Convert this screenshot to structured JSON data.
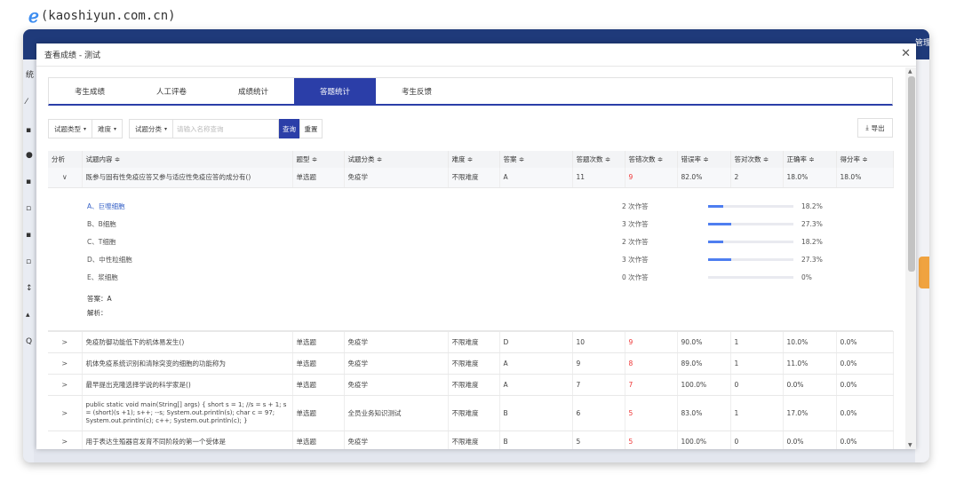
{
  "watermark": "(kaoshiyun.com.cn)",
  "bg": {
    "topright": "管理",
    "sidebar_top": "统"
  },
  "modal": {
    "title": "查看成绩 - 测试"
  },
  "tabs": [
    "考生成绩",
    "人工评卷",
    "成绩统计",
    "答题统计",
    "考生反馈"
  ],
  "active_tab": 3,
  "filters": {
    "type": "试题类型",
    "difficulty": "难度",
    "category": "试题分类",
    "placeholder": "请输入名称查询",
    "query": "查询",
    "reset": "重置",
    "export": "导出"
  },
  "columns": [
    "分析",
    "试题内容 ≑",
    "题型 ≑",
    "试题分类 ≑",
    "难度 ≑",
    "答案 ≑",
    "答题次数 ≑",
    "答错次数 ≑",
    "错误率 ≑",
    "答对次数 ≑",
    "正确率 ≑",
    "得分率 ≑"
  ],
  "rows": [
    {
      "toggle": "∨",
      "content": "既参与固有性免疫应答又参与适应性免疫应答的成分有()",
      "type": "单选题",
      "category": "免疫学",
      "difficulty": "不限难度",
      "answer": "A",
      "attempts": "11",
      "wrong": "9",
      "error_rate": "82.0%",
      "right": "2",
      "correct_rate": "18.0%",
      "score_rate": "18.0%"
    },
    {
      "toggle": ">",
      "content": "免疫防御功能低下的机体易发生()",
      "type": "单选题",
      "category": "免疫学",
      "difficulty": "不限难度",
      "answer": "D",
      "attempts": "10",
      "wrong": "9",
      "error_rate": "90.0%",
      "right": "1",
      "correct_rate": "10.0%",
      "score_rate": "0.0%"
    },
    {
      "toggle": ">",
      "content": "机体免疫系统识别和清除突变的细胞的功能称为",
      "type": "单选题",
      "category": "免疫学",
      "difficulty": "不限难度",
      "answer": "A",
      "attempts": "9",
      "wrong": "8",
      "error_rate": "89.0%",
      "right": "1",
      "correct_rate": "11.0%",
      "score_rate": "0.0%"
    },
    {
      "toggle": ">",
      "content": "最早提出克隆选择学说的科学家是()",
      "type": "单选题",
      "category": "免疫学",
      "difficulty": "不限难度",
      "answer": "A",
      "attempts": "7",
      "wrong": "7",
      "error_rate": "100.0%",
      "right": "0",
      "correct_rate": "0.0%",
      "score_rate": "0.0%"
    },
    {
      "toggle": ">",
      "content": "public static void main(String[] args) { short s = 1; //s = s + 1; s = (short)(s +1); s++; --s; System.out.println(s); char c = 97; System.out.println(c); c++; System.out.println(c); }",
      "type": "单选题",
      "category": "全员业务知识测试",
      "difficulty": "不限难度",
      "answer": "B",
      "attempts": "6",
      "wrong": "5",
      "error_rate": "83.0%",
      "right": "1",
      "correct_rate": "17.0%",
      "score_rate": "0.0%"
    },
    {
      "toggle": ">",
      "content": "用于表达生殖器官发育不同阶段的第一个受体是",
      "type": "单选题",
      "category": "免疫学",
      "difficulty": "不限难度",
      "answer": "B",
      "attempts": "5",
      "wrong": "5",
      "error_rate": "100.0%",
      "right": "0",
      "correct_rate": "0.0%",
      "score_rate": "0.0%"
    }
  ],
  "options": [
    {
      "label": "A、巨噬细胞",
      "count": "2 次作答",
      "pct": "18.2%",
      "fraction": 0.182,
      "selected": true
    },
    {
      "label": "B、B细胞",
      "count": "3 次作答",
      "pct": "27.3%",
      "fraction": 0.273
    },
    {
      "label": "C、T细胞",
      "count": "2 次作答",
      "pct": "18.2%",
      "fraction": 0.182
    },
    {
      "label": "D、中性粒细胞",
      "count": "3 次作答",
      "pct": "27.3%",
      "fraction": 0.273
    },
    {
      "label": "E、浆细胞",
      "count": "0 次作答",
      "pct": "0%",
      "fraction": 0
    }
  ],
  "answer_line": "答案：A",
  "analysis_line": "解析："
}
